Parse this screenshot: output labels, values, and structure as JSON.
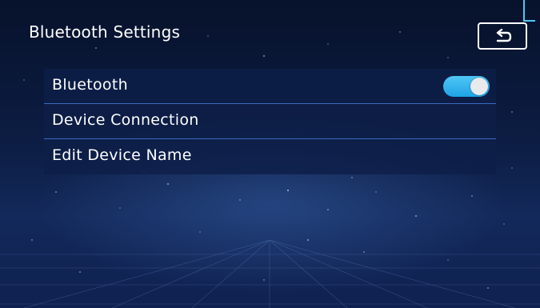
{
  "header": {
    "title": "Bluetooth Settings",
    "back_icon": "back-arrow-icon"
  },
  "menu": {
    "items": [
      {
        "label": "Bluetooth",
        "control": "toggle",
        "state": "on"
      },
      {
        "label": "Device Connection"
      },
      {
        "label": "Edit Device Name"
      }
    ]
  },
  "colors": {
    "toggle_on": "#2fb4ee",
    "row_background": "#0d1e48",
    "row_divider": "#3a6bc0",
    "accent": "#4fc7f4"
  }
}
